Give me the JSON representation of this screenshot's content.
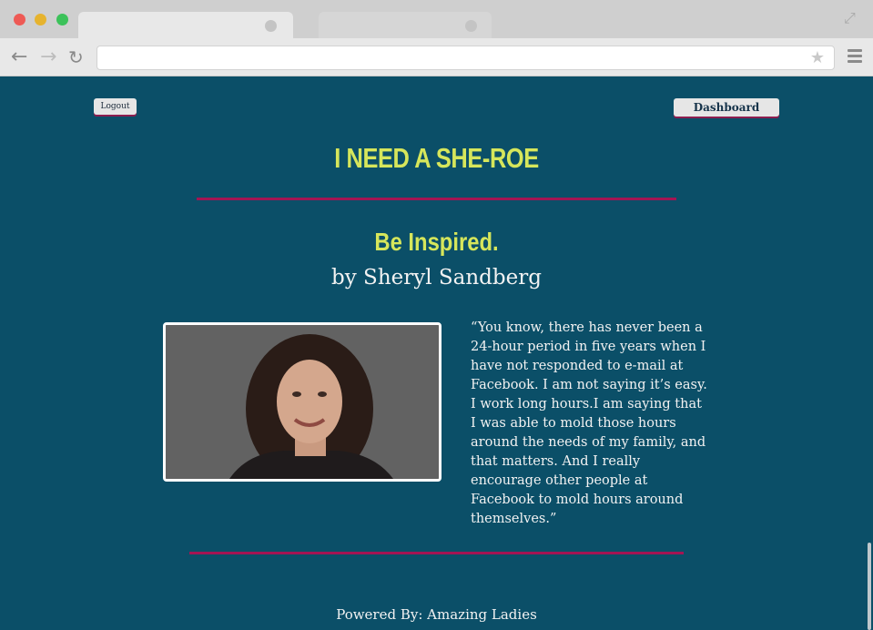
{
  "browser": {
    "url": "",
    "icons": [
      "back-icon",
      "forward-icon",
      "reload-icon",
      "star-icon",
      "menu-icon",
      "fullscreen-icon"
    ]
  },
  "header": {
    "logout_label": "Logout",
    "dashboard_label": "Dashboard",
    "site_title": "I NEED A SHE-ROE"
  },
  "main": {
    "heading": "Be Inspired.",
    "author": "by Sheryl Sandberg",
    "quote": "“You know, there has never been a 24-hour period in five years when I have not responded to e-mail at Facebook. I am not saying it’s easy. I work long hours.I am saying that I was able to mold those hours around the needs of my family, and that matters. And I really encourage other people at Facebook to mold hours around themselves.”"
  },
  "footer": {
    "text": "Powered By: Amazing Ladies"
  },
  "colors": {
    "background": "#0b4f68",
    "accent_title": "#d6e65b",
    "rule": "#a31553"
  }
}
